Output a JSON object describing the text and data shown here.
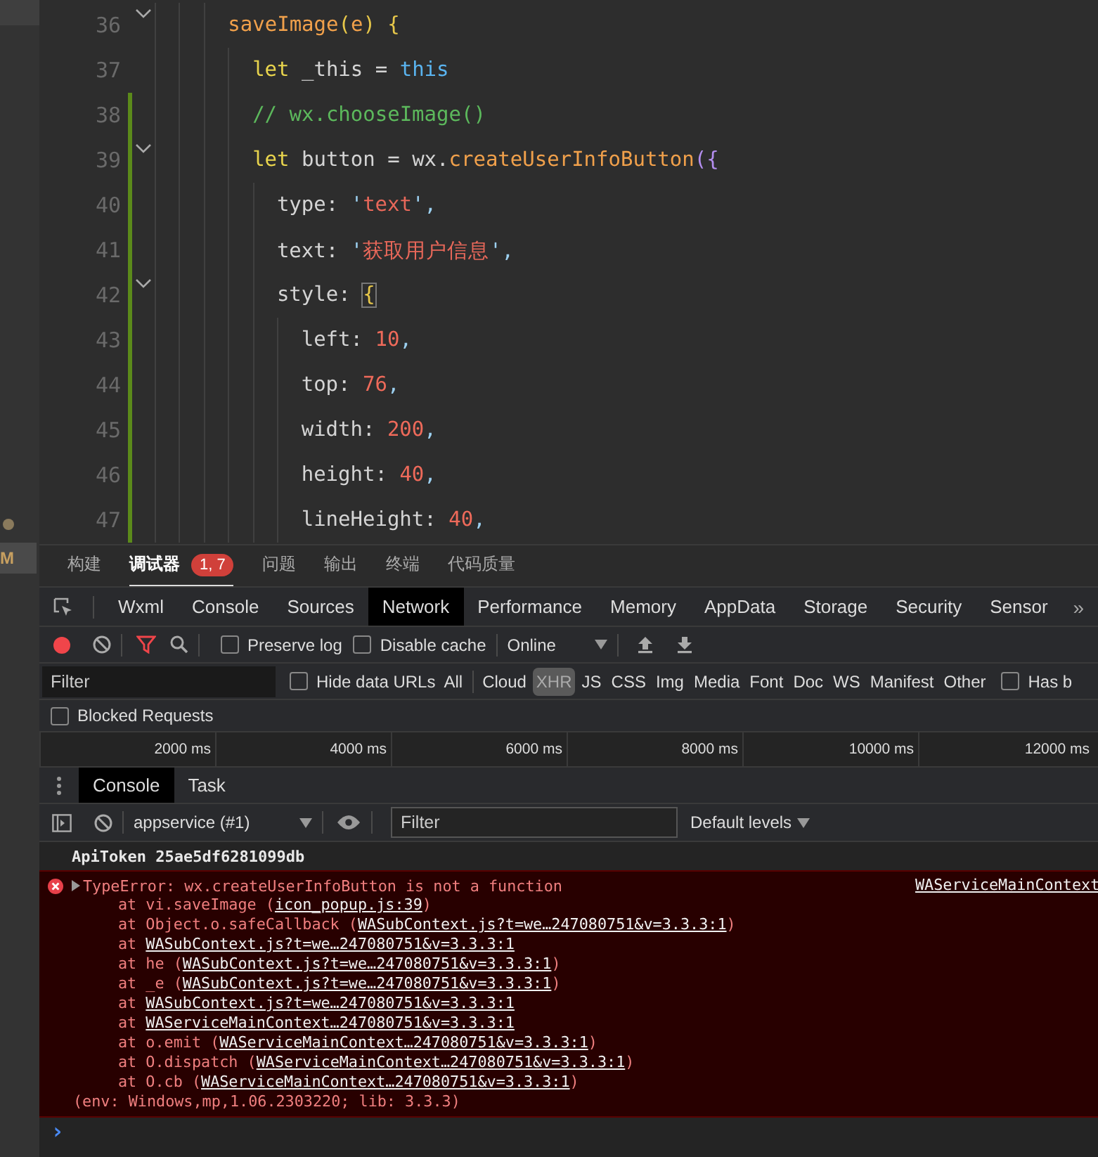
{
  "activity_bar": {
    "badge": "M"
  },
  "editor": {
    "lines": [
      {
        "number": "36",
        "fold": true,
        "changed": false,
        "tokens": [
          {
            "kind": "func",
            "text": "saveImage"
          },
          {
            "kind": "paren",
            "text": "("
          },
          {
            "kind": "func",
            "text": "e"
          },
          {
            "kind": "paren",
            "text": ") {"
          }
        ],
        "children": [
          {
            "number": "37",
            "fold": false,
            "changed": false,
            "tokens": [
              {
                "kind": "keyword",
                "text": "let"
              },
              {
                "kind": "plain",
                "text": " _this = "
              },
              {
                "kind": "this",
                "text": "this"
              }
            ]
          },
          {
            "number": "38",
            "fold": false,
            "changed": true,
            "tokens": [
              {
                "kind": "comment",
                "text": "// wx.chooseImage()"
              }
            ]
          },
          {
            "number": "39",
            "fold": true,
            "changed": true,
            "tokens": [
              {
                "kind": "keyword",
                "text": "let"
              },
              {
                "kind": "plain",
                "text": " button = wx."
              },
              {
                "kind": "func",
                "text": "createUserInfoButton"
              },
              {
                "kind": "bracket",
                "text": "({"
              }
            ],
            "children": [
              {
                "number": "40",
                "fold": false,
                "changed": true,
                "tokens": [
                  {
                    "kind": "plain",
                    "text": "type: "
                  },
                  {
                    "kind": "quote",
                    "text": "'"
                  },
                  {
                    "kind": "string",
                    "text": "text"
                  },
                  {
                    "kind": "quote",
                    "text": "',"
                  }
                ]
              },
              {
                "number": "41",
                "fold": false,
                "changed": true,
                "tokens": [
                  {
                    "kind": "plain",
                    "text": "text: "
                  },
                  {
                    "kind": "quote",
                    "text": "'"
                  },
                  {
                    "kind": "string",
                    "text": "获取用户信息"
                  },
                  {
                    "kind": "quote",
                    "text": "',"
                  }
                ]
              },
              {
                "number": "42",
                "fold": true,
                "changed": true,
                "tokens": [
                  {
                    "kind": "plain",
                    "text": "style: "
                  },
                  {
                    "kind": "match",
                    "text": "{"
                  }
                ],
                "children": [
                  {
                    "number": "43",
                    "fold": false,
                    "changed": true,
                    "tokens": [
                      {
                        "kind": "plain",
                        "text": "left: "
                      },
                      {
                        "kind": "number",
                        "text": "10"
                      },
                      {
                        "kind": "quote",
                        "text": ","
                      }
                    ]
                  },
                  {
                    "number": "44",
                    "fold": false,
                    "changed": true,
                    "tokens": [
                      {
                        "kind": "plain",
                        "text": "top: "
                      },
                      {
                        "kind": "number",
                        "text": "76"
                      },
                      {
                        "kind": "quote",
                        "text": ","
                      }
                    ]
                  },
                  {
                    "number": "45",
                    "fold": false,
                    "changed": true,
                    "tokens": [
                      {
                        "kind": "plain",
                        "text": "width: "
                      },
                      {
                        "kind": "number",
                        "text": "200"
                      },
                      {
                        "kind": "quote",
                        "text": ","
                      }
                    ]
                  },
                  {
                    "number": "46",
                    "fold": false,
                    "changed": true,
                    "tokens": [
                      {
                        "kind": "plain",
                        "text": "height: "
                      },
                      {
                        "kind": "number",
                        "text": "40"
                      },
                      {
                        "kind": "quote",
                        "text": ","
                      }
                    ]
                  },
                  {
                    "number": "47",
                    "fold": false,
                    "changed": true,
                    "tokens": [
                      {
                        "kind": "plain",
                        "text": "lineHeight: "
                      },
                      {
                        "kind": "number",
                        "text": "40"
                      },
                      {
                        "kind": "quote",
                        "text": ","
                      }
                    ]
                  }
                ]
              }
            ]
          }
        ]
      }
    ]
  },
  "panel_tabs": [
    {
      "label": "构建",
      "selected": false
    },
    {
      "label": "调试器",
      "selected": true,
      "badge": "1, 7"
    },
    {
      "label": "问题",
      "selected": false
    },
    {
      "label": "输出",
      "selected": false
    },
    {
      "label": "终端",
      "selected": false
    },
    {
      "label": "代码质量",
      "selected": false
    }
  ],
  "devtools_tabs": [
    {
      "label": "Wxml",
      "selected": false
    },
    {
      "label": "Console",
      "selected": false
    },
    {
      "label": "Sources",
      "selected": false
    },
    {
      "label": "Network",
      "selected": true
    },
    {
      "label": "Performance",
      "selected": false
    },
    {
      "label": "Memory",
      "selected": false
    },
    {
      "label": "AppData",
      "selected": false
    },
    {
      "label": "Storage",
      "selected": false
    },
    {
      "label": "Security",
      "selected": false
    },
    {
      "label": "Sensor",
      "selected": false
    }
  ],
  "devtools_more": "»",
  "network_toolbar": {
    "recording": true,
    "preserve_log": {
      "label": "Preserve log",
      "checked": false
    },
    "disable_cache": {
      "label": "Disable cache",
      "checked": false
    },
    "throttling": "Online"
  },
  "filter_bar": {
    "placeholder": "Filter",
    "hide_data_urls": {
      "label": "Hide data URLs",
      "checked": false
    },
    "types": [
      {
        "label": "All",
        "selected": false
      },
      {
        "label": "Cloud",
        "selected": false
      },
      {
        "label": "XHR",
        "selected": true
      },
      {
        "label": "JS",
        "selected": false
      },
      {
        "label": "CSS",
        "selected": false
      },
      {
        "label": "Img",
        "selected": false
      },
      {
        "label": "Media",
        "selected": false
      },
      {
        "label": "Font",
        "selected": false
      },
      {
        "label": "Doc",
        "selected": false
      },
      {
        "label": "WS",
        "selected": false
      },
      {
        "label": "Manifest",
        "selected": false
      },
      {
        "label": "Other",
        "selected": false
      }
    ],
    "has_blocked": {
      "label": "Has b",
      "checked": false
    },
    "blocked_requests": {
      "label": "Blocked Requests",
      "checked": false
    }
  },
  "timeline": {
    "ticks": [
      "2000 ms",
      "4000 ms",
      "6000 ms",
      "8000 ms",
      "10000 ms",
      "12000 ms"
    ]
  },
  "drawer_tabs": [
    {
      "label": "Console",
      "selected": true
    },
    {
      "label": "Task",
      "selected": false
    }
  ],
  "console_toolbar": {
    "context": "appservice (#1)",
    "filter_placeholder": "Filter",
    "levels": "Default levels"
  },
  "console_messages": [
    {
      "kind": "log",
      "text": "ApiToken 25ae5df6281099db"
    },
    {
      "kind": "error",
      "text": "TypeError: wx.createUserInfoButton is not a function",
      "source": "WAServiceMainContext",
      "frames": [
        {
          "prefix": "at vi.saveImage (",
          "link": "icon_popup.js:39",
          "suffix": ")"
        },
        {
          "prefix": "at Object.o.safeCallback (",
          "link": "WASubContext.js?t=we…247080751&v=3.3.3:1",
          "suffix": ")"
        },
        {
          "prefix": "at ",
          "link": "WASubContext.js?t=we…247080751&v=3.3.3:1"
        },
        {
          "prefix": "at he (",
          "link": "WASubContext.js?t=we…247080751&v=3.3.3:1",
          "suffix": ")"
        },
        {
          "prefix": "at _e (",
          "link": "WASubContext.js?t=we…247080751&v=3.3.3:1",
          "suffix": ")"
        },
        {
          "prefix": "at ",
          "link": "WASubContext.js?t=we…247080751&v=3.3.3:1"
        },
        {
          "prefix": "at ",
          "link": "WAServiceMainContext…247080751&v=3.3.3:1"
        },
        {
          "prefix": "at o.emit (",
          "link": "WAServiceMainContext…247080751&v=3.3.3:1",
          "suffix": ")"
        },
        {
          "prefix": "at O.dispatch (",
          "link": "WAServiceMainContext…247080751&v=3.3.3:1",
          "suffix": ")"
        },
        {
          "prefix": "at O.cb (",
          "link": "WAServiceMainContext…247080751&v=3.3.3:1",
          "suffix": ")"
        }
      ],
      "env": "(env: Windows,mp,1.06.2303220; lib: 3.3.3)"
    }
  ],
  "prompt": "›"
}
